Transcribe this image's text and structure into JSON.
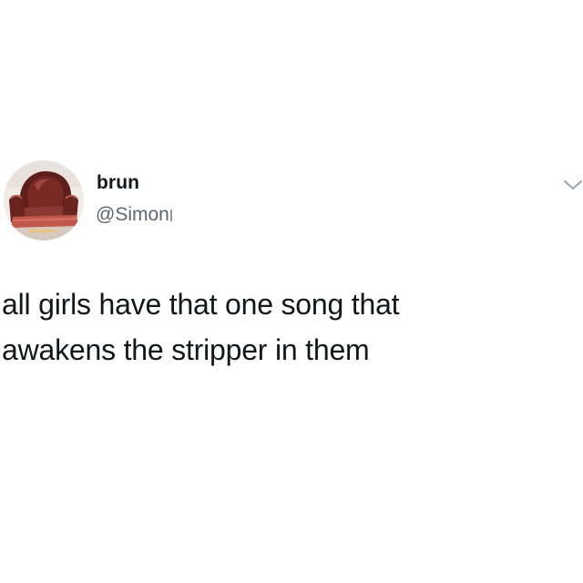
{
  "tweet": {
    "author": {
      "display_name": "brun",
      "handle": "@Simon",
      "avatar": "leather-armchair-photo"
    },
    "menu_icon": "chevron-down-icon",
    "text_lines": [
      "all girls have that one song that",
      "awakens the stripper in them"
    ]
  },
  "colors": {
    "background": "#ffffff",
    "text": "#14171a",
    "secondary_text": "#5b6670",
    "caret": "#9aa4ad"
  }
}
